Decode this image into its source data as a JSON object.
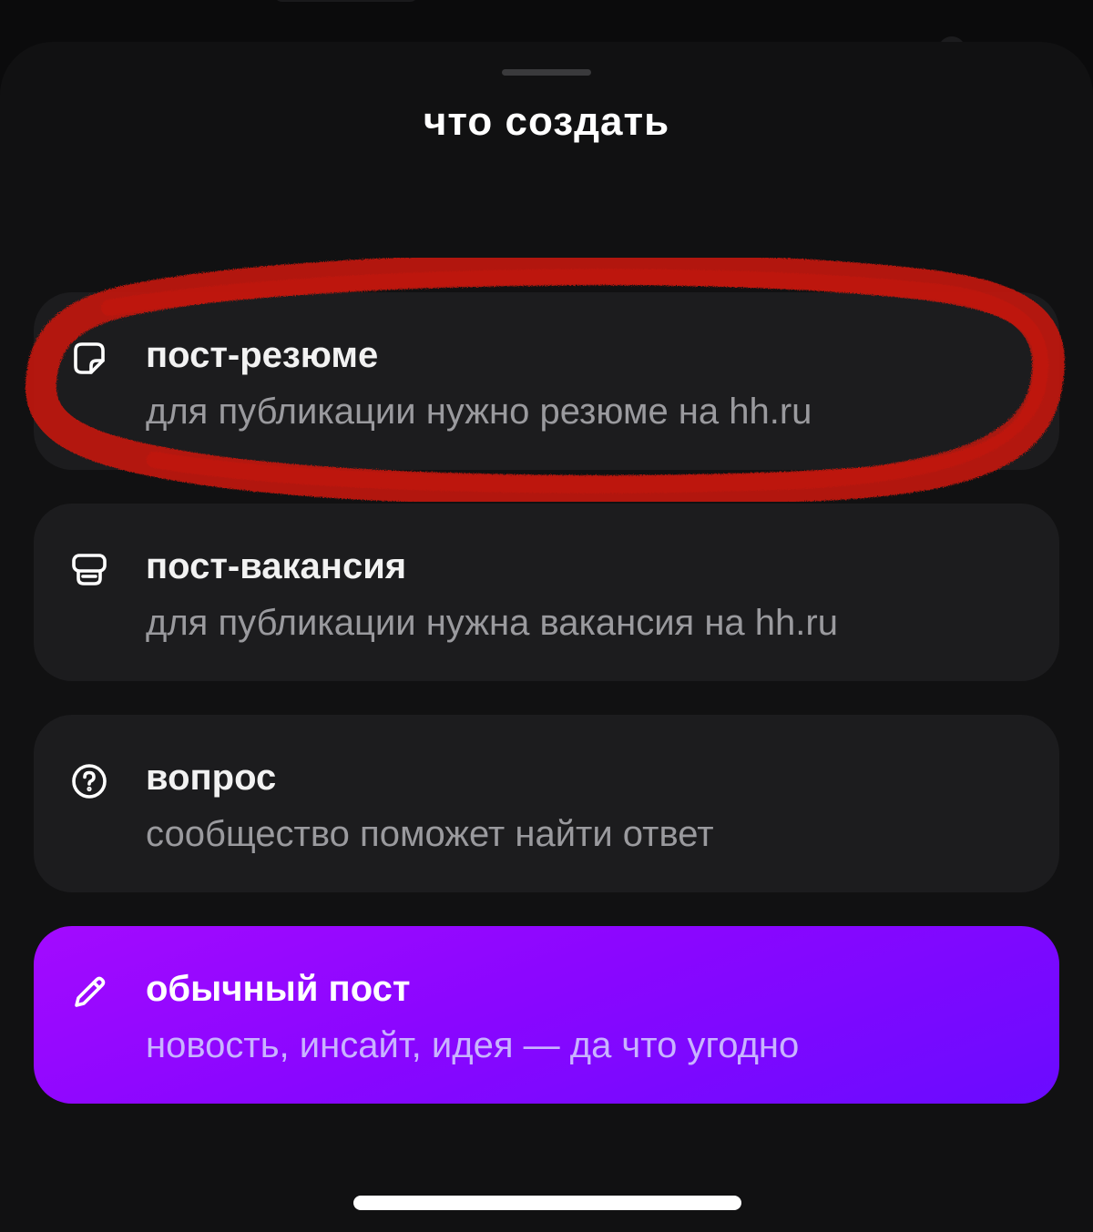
{
  "sheet": {
    "title": "что создать"
  },
  "options": [
    {
      "icon": "resume-sticker-icon",
      "label": "пост-резюме",
      "description": "для публикации нужно резюме на hh.ru"
    },
    {
      "icon": "briefcase-icon",
      "label": "пост-вакансия",
      "description": "для публикации нужна вакансия на hh.ru"
    },
    {
      "icon": "question-circle-icon",
      "label": "вопрос",
      "description": "сообщество поможет найти ответ"
    },
    {
      "icon": "pencil-icon",
      "label": "обычный пост",
      "description": "новость, инсайт, идея — да что угодно"
    }
  ],
  "colors": {
    "sheet_background": "#111112",
    "option_background": "#1c1c1e",
    "primary_gradient_start": "#a30aff",
    "primary_gradient_end": "#6a0bff",
    "highlight_annotation": "#c0190f"
  }
}
